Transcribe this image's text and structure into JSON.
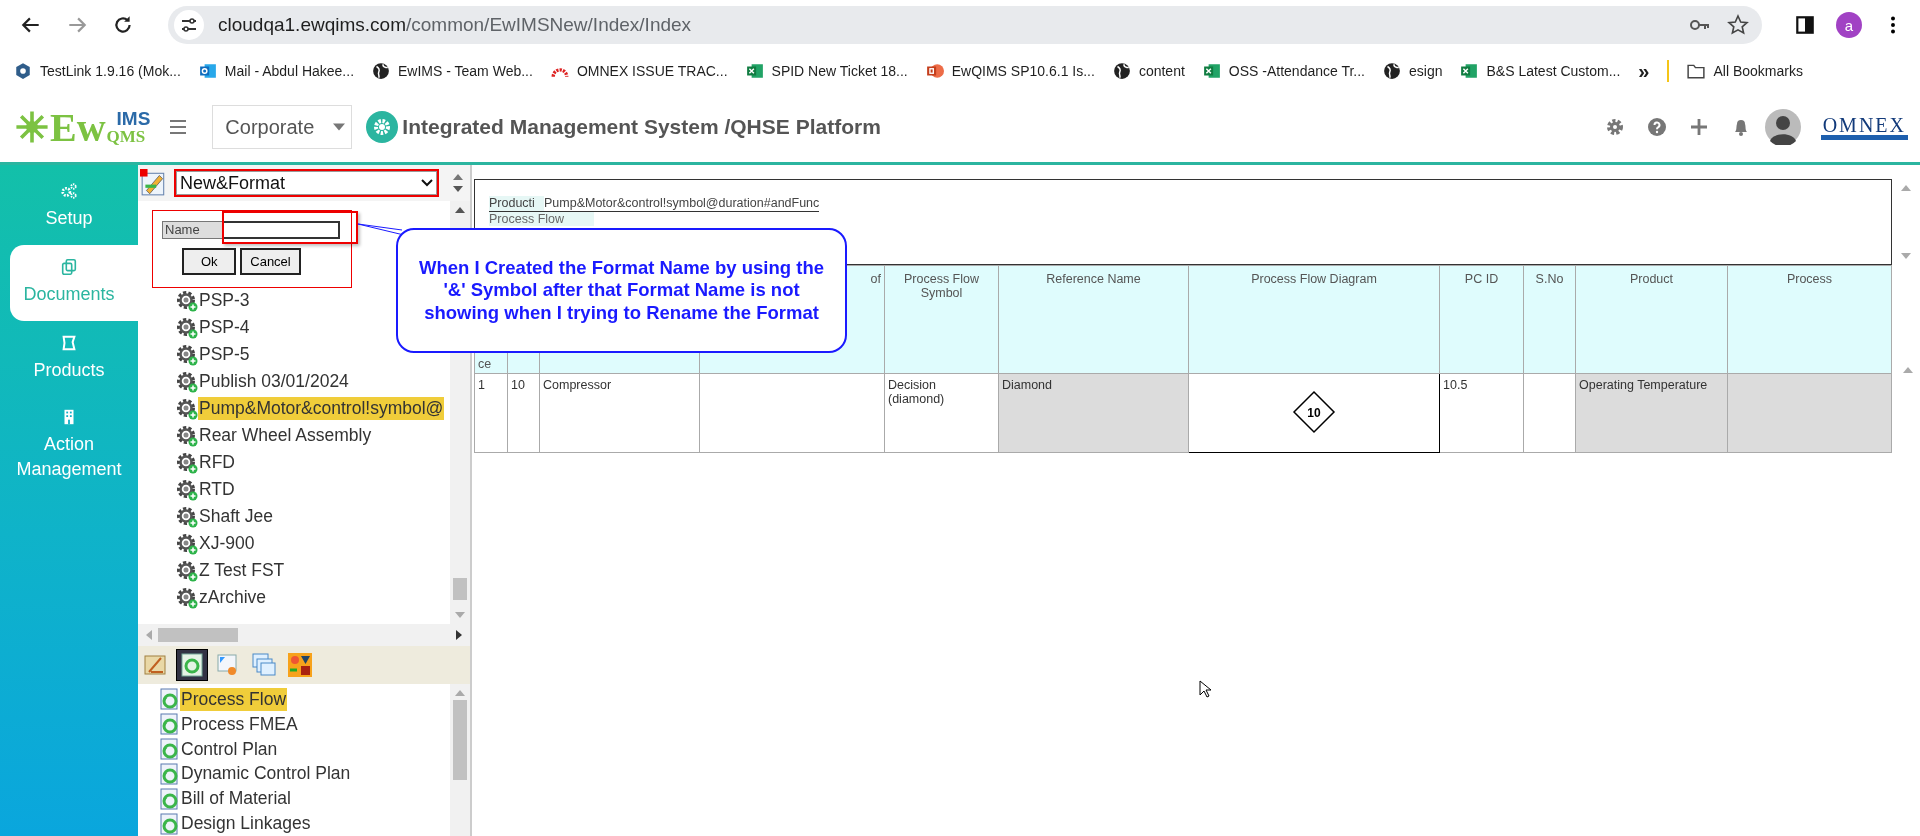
{
  "browser": {
    "url_host": "cloudqa1.ewqims.com",
    "url_path": "/common/EwIMSNew/Index/Index",
    "profile_initial": "a",
    "bookmarks": [
      {
        "label": "TestLink 1.9.16 (Mok...",
        "kind": "hexagon"
      },
      {
        "label": "Mail - Abdul Hakee...",
        "kind": "mail"
      },
      {
        "label": "EwIMS - Team Web...",
        "kind": "globe"
      },
      {
        "label": "OMNEX ISSUE TRAC...",
        "kind": "gauge"
      },
      {
        "label": "SPID New Ticket 18...",
        "kind": "sheet"
      },
      {
        "label": "EwQIMS SP10.6.1 Is...",
        "kind": "slides"
      },
      {
        "label": "content",
        "kind": "globe"
      },
      {
        "label": "OSS -Attendance Tr...",
        "kind": "sheet"
      },
      {
        "label": "esign",
        "kind": "globe"
      },
      {
        "label": "B&S Latest Custom...",
        "kind": "sheet"
      }
    ],
    "more": "»",
    "all_bookmarks": "All Bookmarks"
  },
  "header": {
    "logo_main": "Ew",
    "logo_top": "IMS",
    "logo_bottom": "QMS",
    "site_select": "Corporate",
    "title": "Integrated Management System /QHSE Platform",
    "brand": "OMNEX"
  },
  "sidebar": {
    "items": [
      {
        "label": "Setup",
        "kind": "gears",
        "selected": false
      },
      {
        "label": "Documents",
        "kind": "copy",
        "selected": true
      },
      {
        "label": "Products",
        "kind": "frame",
        "selected": false
      },
      {
        "label": "Action Management",
        "kind": "building",
        "selected": false
      }
    ]
  },
  "format_select": {
    "value": "New&Format"
  },
  "rename_popup": {
    "label": "Name",
    "buttons": [
      "Ok",
      "Cancel"
    ]
  },
  "tree": {
    "items": [
      {
        "label": "PSP-3",
        "selected": false
      },
      {
        "label": "PSP-4",
        "selected": false
      },
      {
        "label": "PSP-5",
        "selected": false
      },
      {
        "label": "Publish 03/01/2024",
        "selected": false
      },
      {
        "label": "Pump&Motor&control!symbol@",
        "selected": true
      },
      {
        "label": "Rear Wheel Assembly",
        "selected": false
      },
      {
        "label": "RFD",
        "selected": false
      },
      {
        "label": "RTD",
        "selected": false
      },
      {
        "label": "Shaft Jee",
        "selected": false
      },
      {
        "label": "XJ-900",
        "selected": false
      },
      {
        "label": "Z Test FST",
        "selected": false
      },
      {
        "label": "zArchive",
        "selected": false
      }
    ]
  },
  "doc_toolbar": [
    {
      "kind": "ruler",
      "selected": false
    },
    {
      "kind": "cycle",
      "selected": true
    },
    {
      "kind": "certificate",
      "selected": false
    },
    {
      "kind": "tables",
      "selected": false
    },
    {
      "kind": "shapes",
      "selected": false
    }
  ],
  "doc_list": {
    "items": [
      {
        "label": "Process Flow",
        "selected": true
      },
      {
        "label": "Process FMEA",
        "selected": false
      },
      {
        "label": "Control Plan",
        "selected": false
      },
      {
        "label": "Dynamic Control Plan",
        "selected": false
      },
      {
        "label": "Bill of Material",
        "selected": false
      },
      {
        "label": "Design Linkages",
        "selected": false
      }
    ]
  },
  "breadcrumb": {
    "segments": [
      "Producti",
      "Pump&Motor&control!symbol@duration#andFunc"
    ],
    "subtitle": "Process Flow"
  },
  "table": {
    "columns": [
      {
        "label": "ce"
      },
      {},
      {},
      {
        "label": "of"
      },
      {
        "label": "Process Flow Symbol"
      },
      {
        "label": "Reference Name"
      },
      {
        "label": "Process Flow Diagram"
      },
      {
        "label": "PC ID"
      },
      {
        "label": "S.No"
      },
      {
        "label": "Product"
      },
      {
        "label": "Process"
      }
    ],
    "rows": [
      {
        "cells": [
          {
            "text": "1",
            "shaded": false
          },
          {
            "text": "10",
            "shaded": false
          },
          {
            "text": "Compressor",
            "shaded": false
          },
          {
            "shaded": false
          },
          {
            "text": "Decision (diamond)",
            "shaded": false
          },
          {
            "text": "Diamond",
            "shaded": true
          },
          {
            "text": "10",
            "kind": "diamond",
            "shaded": false
          },
          {
            "text": "10.5",
            "shaded": false
          },
          {
            "shaded": false
          },
          {
            "text": "Operating Temperature",
            "shaded": true
          },
          {
            "shaded": true
          }
        ]
      }
    ]
  },
  "callout": {
    "text": "When I Created the Format Name by using the '&' Symbol after that Format Name is not showing when I trying to Rename the Format"
  }
}
